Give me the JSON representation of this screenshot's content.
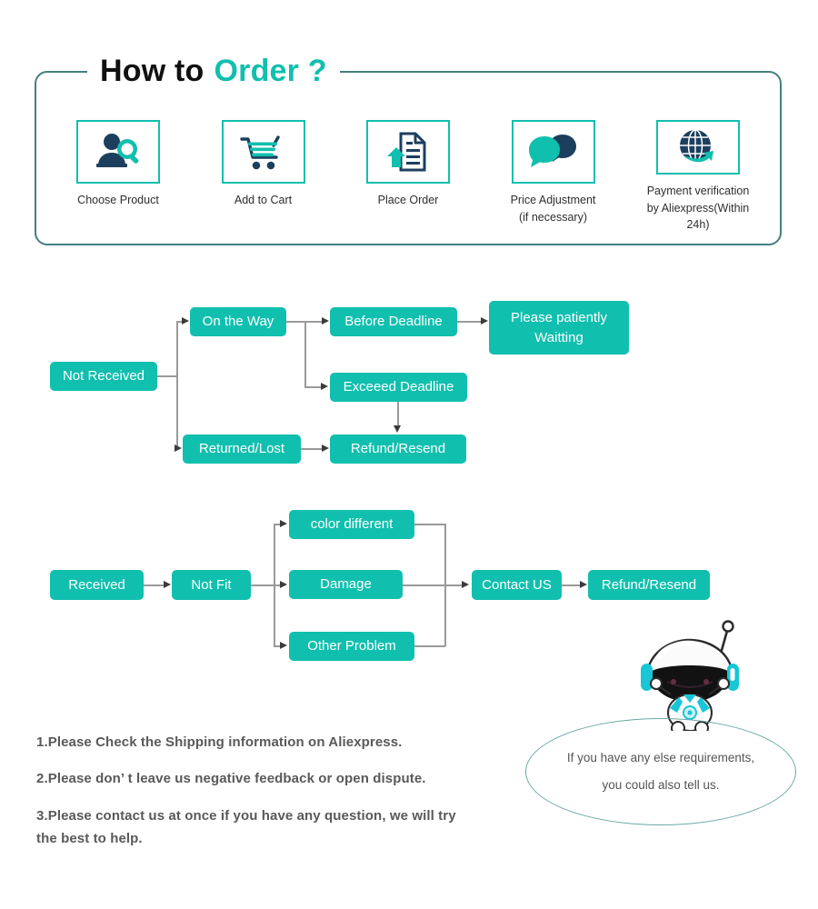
{
  "header": {
    "title_part1": "How to",
    "title_part2": "Order ?",
    "accent_color": "#11bfae",
    "border_color": "#45807d"
  },
  "steps": [
    {
      "icon": "person-search-icon",
      "label_line1": "Choose  Product",
      "label_line2": ""
    },
    {
      "icon": "shopping-cart-icon",
      "label_line1": "Add to Cart",
      "label_line2": ""
    },
    {
      "icon": "document-upload-icon",
      "label_line1": "Place  Order",
      "label_line2": ""
    },
    {
      "icon": "speech-bubbles-icon",
      "label_line1": "Price Adjustment",
      "label_line2": "(if necessary)"
    },
    {
      "icon": "globe-arrow-icon",
      "label_line1": "Payment verification",
      "label_line2": "by Aliexpress(Within 24h)"
    }
  ],
  "flow_not_received": {
    "nodes": {
      "root": "Not Received",
      "on_the_way": "On the Way",
      "returned_lost": "Returned/Lost",
      "before_deadline": "Before Deadline",
      "exceed_deadline": "Exceeed Deadline",
      "waiting_line1": "Please patiently",
      "waiting_line2": "Waitting",
      "refund_resend": "Refund/Resend"
    }
  },
  "flow_received": {
    "nodes": {
      "root": "Received",
      "not_fit": "Not Fit",
      "color_different": "color different",
      "damage": "Damage",
      "other_problem": "Other Problem",
      "contact_us": "Contact US",
      "refund_resend": "Refund/Resend"
    }
  },
  "notes": [
    "1.Please Check the Shipping information on Aliexpress.",
    "2.Please don’ t leave us negative feedback or open dispute.",
    "3.Please contact us at once if you have any question, we will try",
    " the best to help."
  ],
  "bubble": {
    "line1": "If you have any else requirements,",
    "line2": "you could also tell us."
  },
  "theme": {
    "node_fill": "#11bfae",
    "connector": "#9a9a9a",
    "note_text": "#595959"
  }
}
